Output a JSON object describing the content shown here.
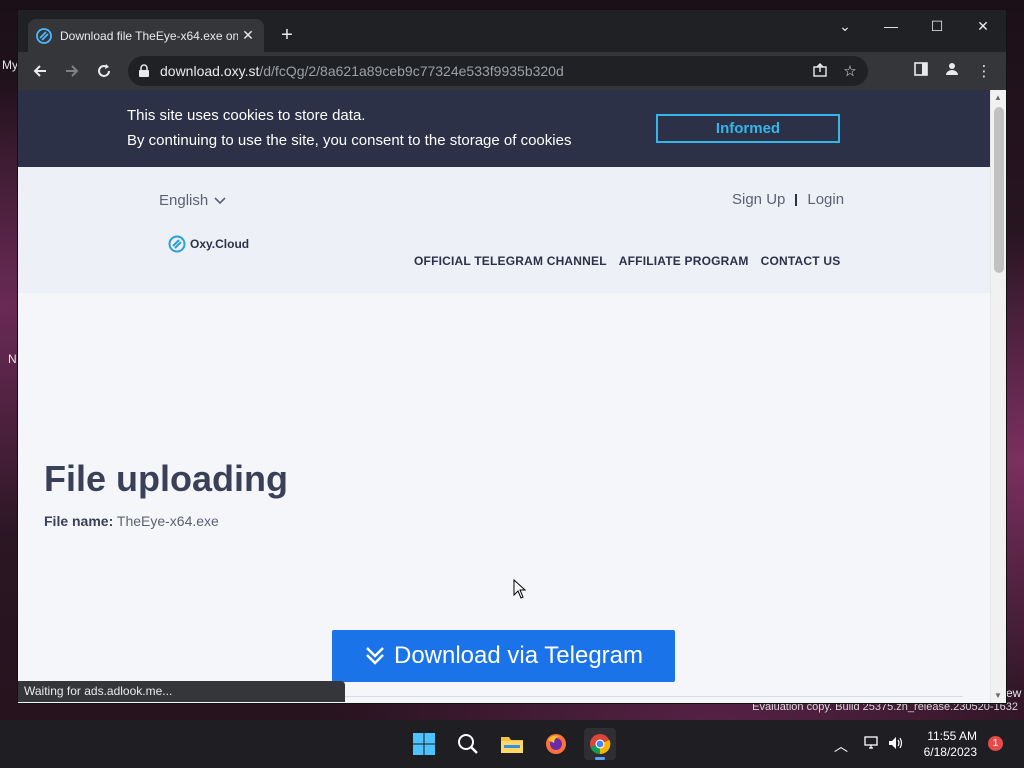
{
  "desktop": {
    "fragments": [
      "My",
      "N",
      "ew"
    ],
    "watermark": "Evaluation copy. Build 25375.zn_release.230520-1632"
  },
  "browser": {
    "tab": {
      "title": "Download file TheEye-x64.exe on",
      "favicon": "oxy-cloud-logo"
    },
    "window_controls": {
      "dropdown": "⌄",
      "minimize": "—",
      "maximize": "☐",
      "close": "✕"
    },
    "url": {
      "host": "download.oxy.st",
      "path": "/d/fcQg/2/8a621a89ceb9c77324e533f9935b320d"
    },
    "status": "Waiting for ads.adlook.me..."
  },
  "page": {
    "cookie": {
      "line1": "This site uses cookies to store data.",
      "line2": "By continuing to use the site, you consent to the storage of cookies",
      "button": "Informed"
    },
    "header": {
      "language": "English",
      "signup": "Sign Up",
      "login": "Login",
      "logo_text": "Oxy.Cloud",
      "nav": [
        "OFFICIAL TELEGRAM CHANNEL",
        "AFFILIATE PROGRAM",
        "CONTACT US"
      ]
    },
    "title": "File uploading",
    "file_label": "File name:",
    "file_name": "TheEye-x64.exe",
    "download_button": "Download via Telegram"
  },
  "taskbar": {
    "apps": [
      "start",
      "search",
      "file-explorer",
      "firefox",
      "chrome"
    ],
    "active_app": "chrome",
    "time": "11:55 AM",
    "date": "6/18/2023",
    "notification_count": "1"
  },
  "colors": {
    "cookie_bar": "#2c3147",
    "accent": "#35b6e8",
    "download": "#1a73e8"
  }
}
